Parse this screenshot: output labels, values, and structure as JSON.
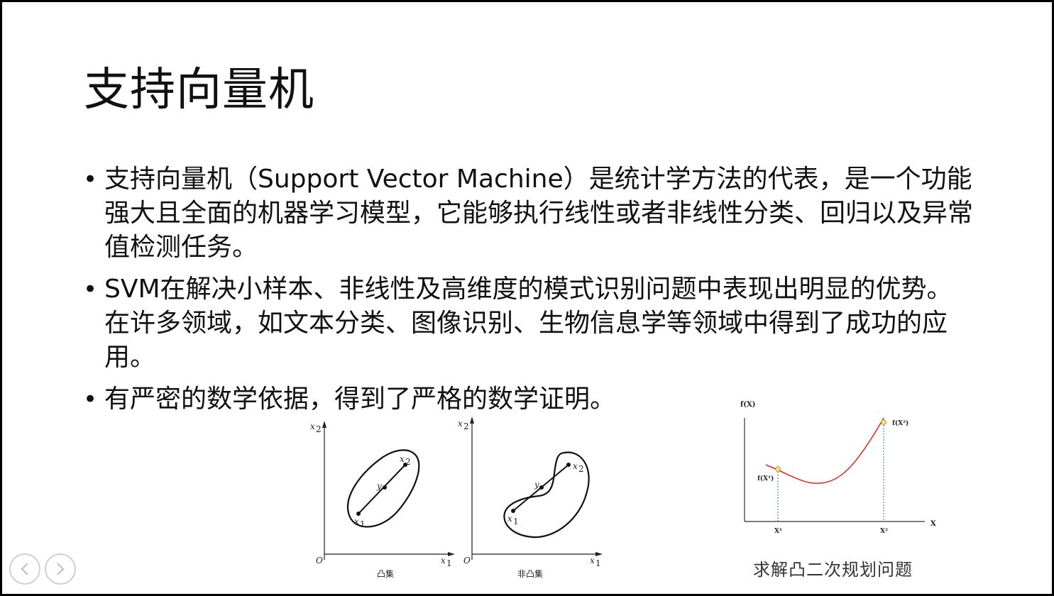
{
  "slide": {
    "title": "支持向量机",
    "bullets": [
      "支持向量机（Support Vector Machine）是统计学方法的代表，是一个功能强大且全面的机器学习模型，它能够执行线性或者非线性分类、回归以及异常值检测任务。",
      "SVM在解决小样本、非线性及高维度的模式识别问题中表现出明显的优势。在许多领域，如文本分类、图像识别、生物信息学等领域中得到了成功的应用。",
      "有严密的数学依据，得到了严格的数学证明。"
    ]
  },
  "figures": {
    "convex_set": {
      "caption": "凸集",
      "axis_y": "x",
      "axis_y_sub": "2",
      "axis_x": "x",
      "axis_x_sub": "1",
      "origin": "O",
      "point_a": "x",
      "point_a_sub": "1",
      "point_b": "x",
      "point_b_sub": "2",
      "point_mid": "y"
    },
    "nonconvex_set": {
      "caption": "非凸集",
      "axis_y": "x",
      "axis_y_sub": "2",
      "axis_x": "x",
      "axis_x_sub": "1",
      "origin": "O",
      "point_a": "x",
      "point_a_sub": "1",
      "point_b": "x",
      "point_b_sub": "2",
      "point_mid": "y"
    },
    "quadratic": {
      "caption": "求解凸二次规划问题",
      "y_label": "f(X)",
      "x_label": "X",
      "x1_label": "X¹",
      "x2_label": "X²",
      "fx1_label": "f(X¹)",
      "fx2_label": "f(X²)",
      "curve_color": "#e8261c",
      "point_color": "#f2e84a"
    }
  },
  "navigation": {
    "prev_icon": "chevron-left-icon",
    "next_icon": "chevron-right-icon"
  }
}
